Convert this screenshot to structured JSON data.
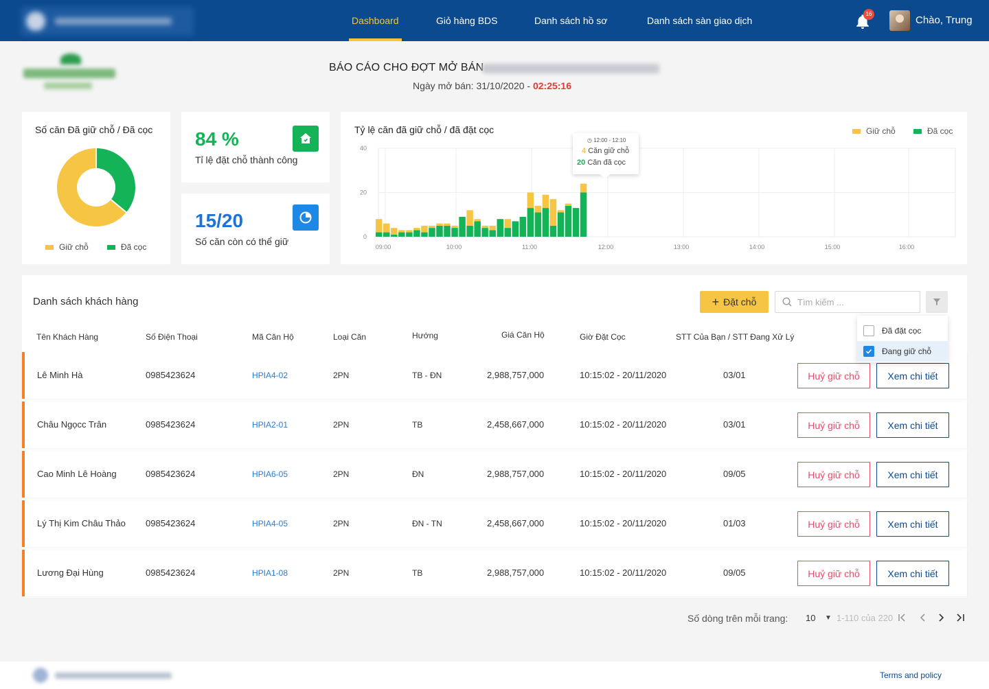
{
  "nav": {
    "items": [
      "Dashboard",
      "Giỏ hàng BDS",
      "Danh sách hồ sơ",
      "Danh sách sàn giao dịch"
    ],
    "notification_count": "16",
    "greeting": "Chào, Trung"
  },
  "report": {
    "title": "BÁO CÁO CHO ĐỢT MỞ BÁN",
    "date_label": "Ngày mở bán: 31/10/2020 - ",
    "countdown": "02:25:16"
  },
  "donut_card": {
    "title": "Số căn Đã giữ chỗ / Đã cọc",
    "legend_hold": "Giữ chỗ",
    "legend_deposit": "Đã cọc"
  },
  "stats": {
    "success_rate_value": "84 %",
    "success_rate_label": "Tỉ lệ đặt chỗ thành công",
    "remaining_value": "15/20",
    "remaining_label": "Số căn còn có thể giữ"
  },
  "colors": {
    "primary": "#0c4a8f",
    "accent_yellow": "#f7c544",
    "accent_green": "#15b358",
    "danger": "#e94b6a",
    "row_border": "#f4812a"
  },
  "chart_data": [
    {
      "type": "pie",
      "title": "Số căn Đã giữ chỗ / Đã cọc",
      "series": [
        {
          "name": "Giữ chỗ",
          "value": 64
        },
        {
          "name": "Đã cọc",
          "value": 36
        }
      ],
      "donut": true
    },
    {
      "type": "bar",
      "stacked": true,
      "title": "Tỷ lệ căn đã giữ chỗ / đã đặt cọc",
      "x_ticks": [
        "09:00",
        "10:00",
        "11:00",
        "12:00",
        "13:00",
        "14:00",
        "15:00",
        "16:00"
      ],
      "y_ticks": [
        0,
        20,
        40
      ],
      "ylim": [
        0,
        40
      ],
      "legend": "top-right",
      "legend_items": [
        "Giữ chỗ",
        "Đã cọc"
      ],
      "series": [
        {
          "name": "Đã cọc",
          "values": [
            2,
            2,
            1,
            2,
            2,
            3,
            2,
            4,
            5,
            5,
            4,
            9,
            5,
            7,
            4,
            3,
            8,
            4,
            7,
            9,
            13,
            11,
            13,
            5,
            11,
            14,
            13,
            20
          ]
        },
        {
          "name": "Giữ chỗ",
          "values": [
            6,
            4,
            3,
            1,
            1,
            1,
            3,
            1,
            1,
            1,
            1,
            0,
            7,
            1,
            1,
            2,
            0,
            4,
            0,
            0,
            7,
            3,
            6,
            12,
            1,
            1,
            0,
            4
          ]
        }
      ],
      "tooltip": {
        "time": "12:00 - 12:10",
        "hold_count": "4",
        "hold_label": "Căn giữ chỗ",
        "deposit_count": "20",
        "deposit_label": "Căn đã cọc"
      }
    }
  ],
  "customers": {
    "title": "Danh sách khách hàng",
    "add_button": "Đặt chỗ",
    "search_placeholder": "Tìm kiếm ...",
    "filter_options": [
      "Đã đặt cọc",
      "Đang giữ chỗ"
    ],
    "filter_selected": "Đang giữ chỗ",
    "columns": [
      "Tên Khách Hàng",
      "Số Điện Thoại",
      "Mã Căn Hộ",
      "Loại Căn",
      "Hướng",
      "Giá Căn Hộ",
      "Giờ Đặt Cọc",
      "STT Của Bạn / STT Đang Xử Lý"
    ],
    "cancel_label": "Huỷ giữ chỗ",
    "detail_label": "Xem chi tiết",
    "rows": [
      {
        "name": "Lê Minh Hà",
        "phone": "0985423624",
        "code": "HPIA4-02",
        "type": "2PN",
        "direction": "TB -  ĐN",
        "price": "2,988,757,000",
        "time": "10:15:02 - 20/11/2020",
        "stt": "03/01"
      },
      {
        "name": "Châu Ngọcc Trân",
        "phone": "0985423624",
        "code": "HPIA2-01",
        "type": "2PN",
        "direction": "TB",
        "price": "2,458,667,000",
        "time": "10:15:02 - 20/11/2020",
        "stt": "03/01"
      },
      {
        "name": "Cao Minh Lê Hoàng",
        "phone": "0985423624",
        "code": "HPIA6-05",
        "type": "2PN",
        "direction": "ĐN",
        "price": "2,988,757,000",
        "time": "10:15:02 - 20/11/2020",
        "stt": "09/05"
      },
      {
        "name": "Lý Thị Kim Châu Thảo",
        "phone": "0985423624",
        "code": "HPIA4-05",
        "type": "2PN",
        "direction": "ĐN - TN",
        "price": "2,458,667,000",
        "time": "10:15:02 - 20/11/2020",
        "stt": "01/03"
      },
      {
        "name": "Lương Đại Hùng",
        "phone": "0985423624",
        "code": "HPIA1-08",
        "type": "2PN",
        "direction": "TB",
        "price": "2,988,757,000",
        "time": "10:15:02 - 20/11/2020",
        "stt": "09/05"
      }
    ]
  },
  "pagination": {
    "rows_label": "Số dòng trên mỗi trang:",
    "rows_value": "10",
    "range": "1-110 của 220"
  },
  "footer": {
    "terms": "Terms and policy"
  },
  "icons": [
    "bell-icon",
    "house-icon",
    "pie-icon",
    "search-icon",
    "filter-icon",
    "plus-icon",
    "clock-icon",
    "chevron-down-icon",
    "first-page-icon",
    "prev-page-icon",
    "next-page-icon",
    "last-page-icon",
    "check-icon"
  ]
}
